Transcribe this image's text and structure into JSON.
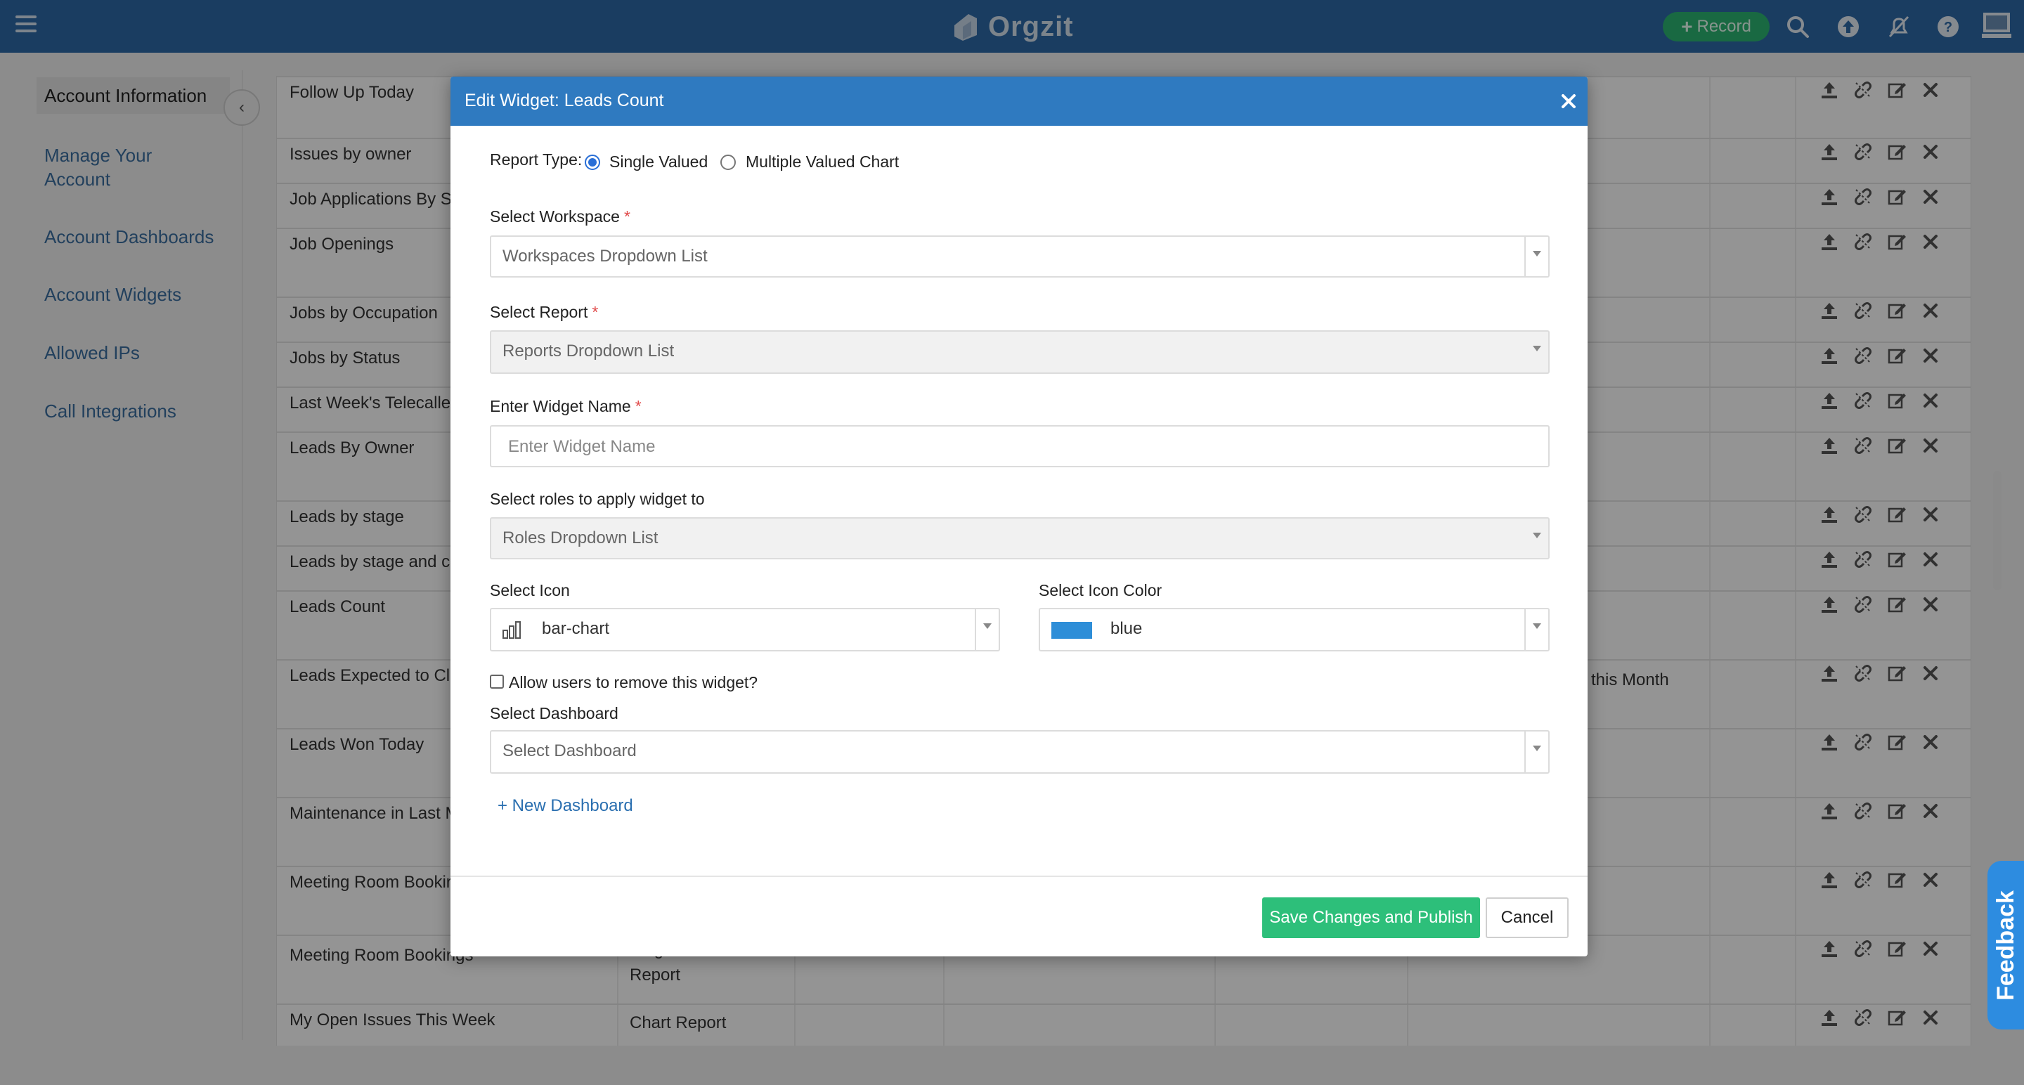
{
  "navbar": {
    "brand": "Orgzit",
    "record_label": "Record"
  },
  "sidebar": {
    "items": [
      {
        "label": "Account Information"
      },
      {
        "label": "Manage Your Account"
      },
      {
        "label": "Account Dashboards"
      },
      {
        "label": "Account Widgets"
      },
      {
        "label": "Allowed IPs"
      },
      {
        "label": "Call Integrations"
      }
    ]
  },
  "table": {
    "rows": [
      {
        "name": "Follow Up Today",
        "type": "",
        "desc": ""
      },
      {
        "name": "Issues by owner",
        "type": "",
        "desc": ""
      },
      {
        "name": "Job Applications By St",
        "type": "",
        "desc": ""
      },
      {
        "name": "Job Openings",
        "type": "",
        "desc": ""
      },
      {
        "name": "Jobs by Occupation",
        "type": "",
        "desc": ""
      },
      {
        "name": "Jobs by Status",
        "type": "",
        "desc": ""
      },
      {
        "name": "Last Week's Telecaller",
        "type": "",
        "desc": ""
      },
      {
        "name": "Leads By Owner",
        "type": "",
        "desc": ""
      },
      {
        "name": "Leads by stage",
        "type": "",
        "desc": ""
      },
      {
        "name": "Leads by stage and co",
        "type": "",
        "desc": ""
      },
      {
        "name": "Leads Count",
        "type": "",
        "desc": ""
      },
      {
        "name": "Leads Expected to Clo",
        "type": "",
        "desc": "e this Month"
      },
      {
        "name": "Leads Won Today",
        "type": "",
        "desc": ""
      },
      {
        "name": "Maintenance in Last M",
        "type": "",
        "desc": ""
      },
      {
        "name": "Meeting Room Bookir",
        "type": "",
        "desc": ""
      },
      {
        "name": "Meeting Room Bookings",
        "type": "Single Valued Report",
        "type_line1": "Single Valued",
        "type_line2": "Report",
        "desc": ""
      },
      {
        "name": "My Open Issues This Week",
        "type": "Chart Report",
        "desc": ""
      }
    ]
  },
  "modal": {
    "title": "Edit Widget: Leads Count",
    "report_type_label": "Report Type:",
    "report_type_options": [
      "Single Valued",
      "Multiple Valued Chart"
    ],
    "report_type_selected": "Single Valued",
    "workspace_label": "Select Workspace",
    "workspace_value": "Workspaces Dropdown List",
    "report_label": "Select Report",
    "report_value": "Reports Dropdown List",
    "widget_name_label": "Enter Widget Name",
    "widget_name_placeholder": "Enter Widget Name",
    "roles_label": "Select roles to apply widget to",
    "roles_value": "Roles Dropdown List",
    "icon_label": "Select Icon",
    "icon_value": "bar-chart",
    "icon_color_label": "Select Icon Color",
    "icon_color_value": "blue",
    "icon_color_hex": "#2e8ed8",
    "allow_remove_label": "Allow users to remove this widget?",
    "allow_remove_checked": false,
    "dashboard_label": "Select Dashboard",
    "dashboard_value": "Select Dashboard",
    "new_dashboard_link": "+ New Dashboard",
    "save_label": "Save Changes and Publish",
    "cancel_label": "Cancel"
  },
  "feedback_label": "Feedback",
  "colors": {
    "navbar": "#2e6aa8",
    "modal_header": "#2f7ac0",
    "save_button": "#2dbf7a",
    "record_button": "#2bb673",
    "feedback_tab": "#2d8ce0"
  }
}
